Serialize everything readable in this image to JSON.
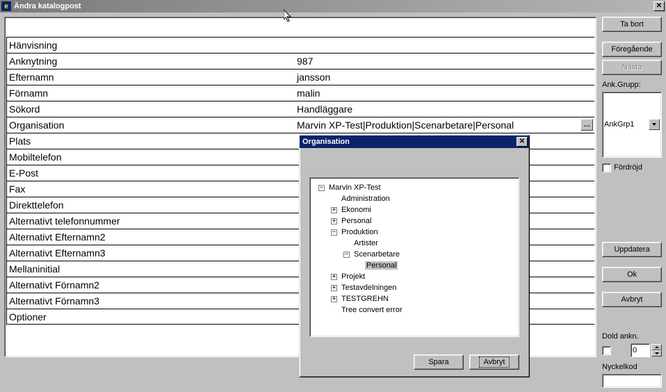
{
  "window": {
    "title": "Ändra katalogpost"
  },
  "rows": [
    {
      "label": "Hänvisning",
      "value": ""
    },
    {
      "label": "Anknytning",
      "value": "987"
    },
    {
      "label": "Efternamn",
      "value": "jansson"
    },
    {
      "label": "Förnamn",
      "value": "malin"
    },
    {
      "label": "Sökord",
      "value": "Handläggare"
    },
    {
      "label": "Organisation",
      "value": "Marvin XP-Test|Produktion|Scenarbetare|Personal",
      "browse": true
    },
    {
      "label": "Plats",
      "value": ""
    },
    {
      "label": "Mobiltelefon",
      "value": ""
    },
    {
      "label": "E-Post",
      "value": ""
    },
    {
      "label": "Fax",
      "value": ""
    },
    {
      "label": "Direkttelefon",
      "value": ""
    },
    {
      "label": "Alternativt telefonnummer",
      "value": ""
    },
    {
      "label": "Alternativt Efternamn2",
      "value": ""
    },
    {
      "label": "Alternativt Efternamn3",
      "value": ""
    },
    {
      "label": "Mellaninitial",
      "value": ""
    },
    {
      "label": "Alternativt Förnamn2",
      "value": ""
    },
    {
      "label": "Alternativt Förnamn3",
      "value": ""
    },
    {
      "label": "Optioner",
      "value": ""
    }
  ],
  "buttons": {
    "delete": "Ta bort",
    "prev": "Föregående",
    "next": "Nästa",
    "group_label": "Ank.Grupp:",
    "group_value": "AnkGrp1",
    "delayed": "Fördröjd",
    "update": "Uppdatera",
    "ok": "Ok",
    "cancel": "Avbryt",
    "hidden_ext": "Dold ankn.",
    "spinner_value": "0",
    "keycode": "Nyckelkod"
  },
  "modal": {
    "title": "Organisation",
    "save": "Spara",
    "cancel": "Avbryt",
    "tree": [
      {
        "indent": 0,
        "toggle": "-",
        "label": "Marvin XP-Test"
      },
      {
        "indent": 1,
        "toggle": "",
        "label": "Administration"
      },
      {
        "indent": 1,
        "toggle": "+",
        "label": "Ekonomi"
      },
      {
        "indent": 1,
        "toggle": "+",
        "label": "Personal"
      },
      {
        "indent": 1,
        "toggle": "-",
        "label": "Produktion"
      },
      {
        "indent": 2,
        "toggle": "",
        "label": "Artister"
      },
      {
        "indent": 2,
        "toggle": "-",
        "label": "Scenarbetare"
      },
      {
        "indent": 3,
        "toggle": "",
        "label": "Personal",
        "selected": true
      },
      {
        "indent": 1,
        "toggle": "+",
        "label": "Projekt"
      },
      {
        "indent": 1,
        "toggle": "+",
        "label": "Testavdelningen"
      },
      {
        "indent": 1,
        "toggle": "+",
        "label": "TESTGREHN"
      },
      {
        "indent": 1,
        "toggle": "",
        "label": "Tree convert error"
      }
    ]
  }
}
